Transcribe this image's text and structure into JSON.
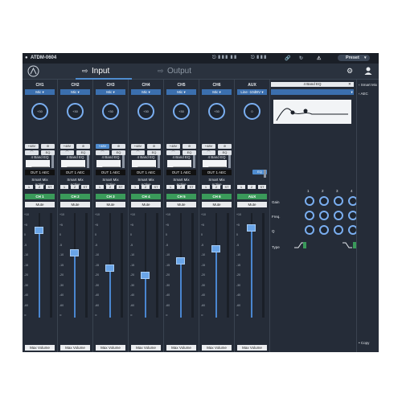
{
  "device": {
    "name": "ATDM-0604",
    "preset_label": "Preset"
  },
  "tabs": [
    {
      "label": "Input",
      "active": true
    },
    {
      "label": "Output",
      "active": false
    }
  ],
  "channels": [
    {
      "name": "CH1",
      "source": "Mic",
      "gain_value": "+30",
      "phantom": "+48V",
      "phantom_on": false,
      "eq_label": "4 Band EQ",
      "output": "OUT 1 AEC",
      "smart_mix": "Smart Mix",
      "active": "Active",
      "groups": [
        "1",
        "2",
        "ST"
      ],
      "strip_label": "CH 1",
      "mute": "Mute",
      "fader_pct": 0.84,
      "max_volume": "Max Volume"
    },
    {
      "name": "CH2",
      "source": "Mic",
      "gain_value": "+30",
      "phantom": "+48V",
      "phantom_on": false,
      "eq_label": "4 Band EQ",
      "output": "OUT 1 AEC",
      "smart_mix": "Smart Mix",
      "active": "Active",
      "groups": [
        "1",
        "2",
        "ST"
      ],
      "strip_label": "CH 2",
      "mute": "Mute",
      "fader_pct": 0.62,
      "max_volume": "Max Volume"
    },
    {
      "name": "CH3",
      "source": "Mic",
      "gain_value": "+30",
      "phantom": "+48V",
      "phantom_on": true,
      "eq_label": "4 Band EQ",
      "output": "OUT 1 AEC",
      "smart_mix": "Smart Mix",
      "active": "Active",
      "groups": [
        "1",
        "2",
        "ST"
      ],
      "strip_label": "CH 3",
      "mute": "Mute",
      "fader_pct": 0.48,
      "max_volume": "Max Volume"
    },
    {
      "name": "CH4",
      "source": "Mic",
      "gain_value": "+30",
      "phantom": "+48V",
      "phantom_on": false,
      "eq_label": "4 Band EQ",
      "output": "OUT 1 AEC",
      "smart_mix": "Smart Mix",
      "active": "Active",
      "groups": [
        "1",
        "2",
        "ST"
      ],
      "strip_label": "CH 4",
      "mute": "Mute",
      "fader_pct": 0.41,
      "max_volume": "Max Volume"
    },
    {
      "name": "CH5",
      "source": "Mic",
      "gain_value": "+30",
      "phantom": "+48V",
      "phantom_on": false,
      "eq_label": "4 Band EQ",
      "output": "OUT 1 AEC",
      "smart_mix": "Smart Mix",
      "active": "Active",
      "groups": [
        "1",
        "2",
        "ST"
      ],
      "strip_label": "CH 5",
      "mute": "Mute",
      "fader_pct": 0.55,
      "max_volume": "Max Volume"
    },
    {
      "name": "CH6",
      "source": "Mic",
      "gain_value": "+30",
      "phantom": "+48V",
      "phantom_on": false,
      "eq_label": "4 Band EQ",
      "output": "OUT 1 AEC",
      "smart_mix": "Smart Mix",
      "active": "Active",
      "groups": [
        "1",
        "2",
        "ST"
      ],
      "strip_label": "CH 6",
      "mute": "Mute",
      "fader_pct": 0.66,
      "max_volume": "Max Volume"
    },
    {
      "name": "AUX",
      "source": "Line -10dBV",
      "gain_value": "0",
      "eq_label": "EQ",
      "groups": [
        "1",
        "2",
        "ST"
      ],
      "strip_label": "AUX",
      "mute": "Mute",
      "fader_pct": 0.86,
      "max_volume": "Max Volume"
    }
  ],
  "eq_panel": {
    "title": "4 Band EQ",
    "bands": [
      "1",
      "2",
      "3",
      "4"
    ],
    "row_labels": {
      "gain": "Gain",
      "freq": "Freq.",
      "q": "Q",
      "type": "Type"
    }
  },
  "right_panel": {
    "items": [
      "Smart Mix",
      "AEC"
    ],
    "copy_label": "Copy"
  },
  "colors": {
    "background": "#252c38",
    "accent": "#4f8ccf",
    "active_green": "#3a9a5a"
  }
}
